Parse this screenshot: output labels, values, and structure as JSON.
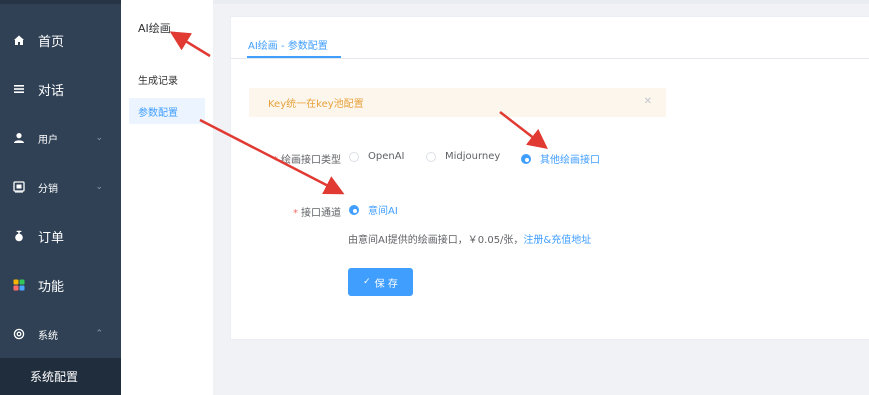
{
  "sidebar": {
    "items": [
      {
        "label": "首页",
        "icon": "home-icon"
      },
      {
        "label": "对话",
        "icon": "menu-lines-icon"
      },
      {
        "label": "用户",
        "icon": "user-icon"
      },
      {
        "label": "分销",
        "icon": "share-icon"
      },
      {
        "label": "订单",
        "icon": "order-icon"
      },
      {
        "label": "功能",
        "icon": "grid-icon"
      },
      {
        "label": "系统",
        "icon": "gear-icon"
      }
    ],
    "active_sub": "系统配置"
  },
  "subsidebar": {
    "title": "AI绘画",
    "items": [
      {
        "label": "生成记录"
      },
      {
        "label": "参数配置"
      }
    ]
  },
  "main": {
    "tab": "AI绘画 - 参数配置",
    "alert": "Key统一在key池配置",
    "form": {
      "type_label": "绘画接口类型",
      "type_options": [
        "OpenAI",
        "Midjourney",
        "其他绘画接口"
      ],
      "type_selected": "其他绘画接口",
      "channel_label": "接口通道",
      "channel_option": "意间AI",
      "hint_text": "由意间AI提供的绘画接口，￥0.05/张，",
      "hint_link": "注册&充值地址",
      "save_label": "保 存"
    }
  },
  "colors": {
    "primary": "#409eff",
    "sidebar_bg": "#304156",
    "warning": "#e6a23c",
    "annotation_red": "#e03a33"
  }
}
